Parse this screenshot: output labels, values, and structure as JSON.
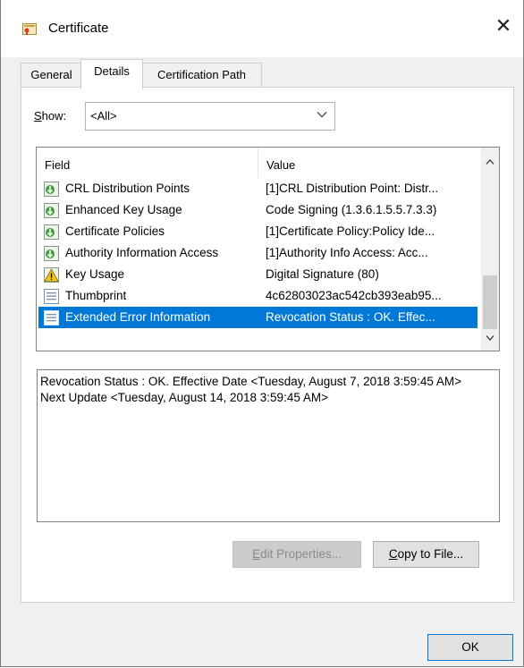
{
  "window": {
    "title": "Certificate",
    "icon": "certificate-icon",
    "close_glyph": "✕"
  },
  "tabs": [
    {
      "label": "General",
      "active": false
    },
    {
      "label": "Details",
      "active": true
    },
    {
      "label": "Certification Path",
      "active": false
    }
  ],
  "show": {
    "label_prefix": "",
    "label_accel": "S",
    "label_rest": "how:",
    "selected": "<All>"
  },
  "list": {
    "headers": {
      "field": "Field",
      "value": "Value"
    },
    "rows": [
      {
        "field": "CRL Distribution Points",
        "value": "[1]CRL Distribution Point: Distr...",
        "icon": "extension-icon",
        "selected": false
      },
      {
        "field": "Enhanced Key Usage",
        "value": "Code Signing (1.3.6.1.5.5.7.3.3)",
        "icon": "extension-icon",
        "selected": false
      },
      {
        "field": "Certificate Policies",
        "value": "[1]Certificate Policy:Policy Ide...",
        "icon": "extension-icon",
        "selected": false
      },
      {
        "field": "Authority Information Access",
        "value": "[1]Authority Info Access: Acc...",
        "icon": "extension-icon",
        "selected": false
      },
      {
        "field": "Key Usage",
        "value": "Digital Signature (80)",
        "icon": "warning-extension-icon",
        "selected": false
      },
      {
        "field": "Thumbprint",
        "value": "4c62803023ac542cb393eab95...",
        "icon": "property-icon",
        "selected": false
      },
      {
        "field": "Extended Error Information",
        "value": "Revocation Status : OK. Effec...",
        "icon": "property-icon",
        "selected": true
      }
    ]
  },
  "detail": {
    "text": "Revocation Status : OK. Effective Date <Tuesday, August 7, 2018 3:59:45 AM> Next Update <Tuesday, August 14, 2018 3:59:45 AM>"
  },
  "buttons": {
    "edit_accel": "E",
    "edit_rest": "dit Properties...",
    "copy_accel": "C",
    "copy_rest": "opy to File...",
    "ok": "OK"
  }
}
